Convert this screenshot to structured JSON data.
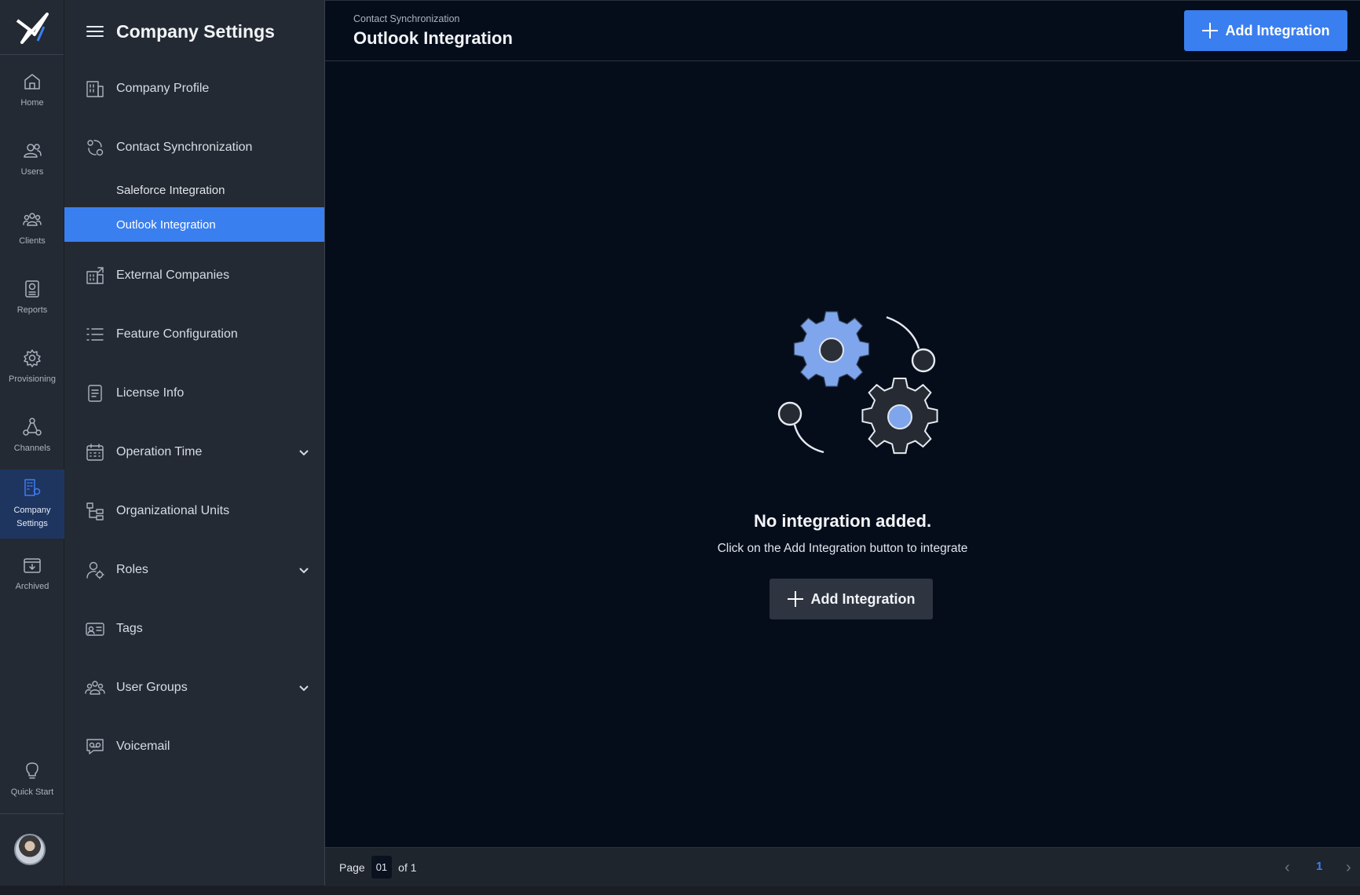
{
  "rail": {
    "items": [
      {
        "label": "Home",
        "icon": "home-icon"
      },
      {
        "label": "Users",
        "icon": "users-icon"
      },
      {
        "label": "Clients",
        "icon": "clients-icon"
      },
      {
        "label": "Reports",
        "icon": "reports-icon"
      },
      {
        "label": "Provisioning",
        "icon": "gear-icon"
      },
      {
        "label": "Channels",
        "icon": "channels-icon"
      },
      {
        "label": "Company\nSettings",
        "icon": "company-settings-icon"
      },
      {
        "label": "Archived",
        "icon": "archive-icon"
      }
    ],
    "quick_start": "Quick Start"
  },
  "panel": {
    "title": "Company Settings",
    "items": [
      {
        "label": "Company Profile",
        "icon": "building-icon"
      },
      {
        "label": "Contact Synchronization",
        "icon": "sync-icon"
      },
      {
        "label": "External Companies",
        "icon": "external-companies-icon"
      },
      {
        "label": "Feature Configuration",
        "icon": "list-icon"
      },
      {
        "label": "License Info",
        "icon": "document-icon"
      },
      {
        "label": "Operation Time",
        "icon": "calendar-icon"
      },
      {
        "label": "Organizational Units",
        "icon": "org-tree-icon"
      },
      {
        "label": "Roles",
        "icon": "user-gear-icon"
      },
      {
        "label": "Tags",
        "icon": "tag-card-icon"
      },
      {
        "label": "User Groups",
        "icon": "user-groups-icon"
      },
      {
        "label": "Voicemail",
        "icon": "voicemail-icon"
      }
    ],
    "sub_items": [
      {
        "label": "Saleforce Integration"
      },
      {
        "label": "Outlook Integration"
      }
    ]
  },
  "header": {
    "breadcrumb": "Contact Synchronization",
    "title": "Outlook Integration",
    "add_button": "Add Integration"
  },
  "empty_state": {
    "title": "No integration added.",
    "subtitle": "Click on the Add Integration button to integrate",
    "button": "Add Integration"
  },
  "footer": {
    "page_label": "Page",
    "page_value": "01",
    "of_label": "of 1",
    "current_page": "1"
  },
  "colors": {
    "accent": "#3a7ff0",
    "sidebar": "#242a33",
    "main_bg": "#050d1b"
  }
}
